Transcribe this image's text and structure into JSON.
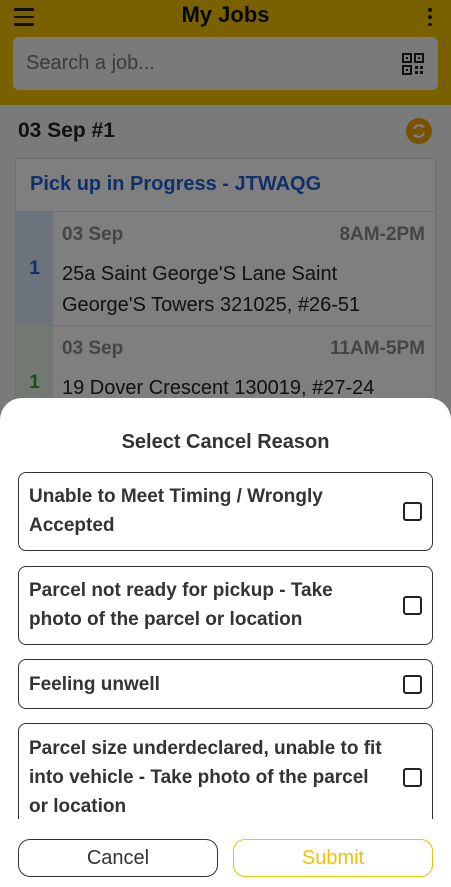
{
  "app_bar": {
    "title": "My Jobs"
  },
  "search": {
    "placeholder": "Search a job..."
  },
  "group": {
    "date_label": "03 Sep #1"
  },
  "card": {
    "status": "Pick up in Progress - JTWAQG",
    "jobs": [
      {
        "seq": "1",
        "date": "03 Sep",
        "time": "8AM-2PM",
        "address": "25a Saint George'S Lane Saint George'S Towers 321025, #26-51",
        "color": "#1e63d6",
        "stripe": "#dbe6f8"
      },
      {
        "seq": "1",
        "date": "03 Sep",
        "time": "11AM-5PM",
        "address": "19 Dover Crescent 130019, #27-24",
        "color": "#2e9b3a",
        "stripe": "#e3f2e0"
      }
    ]
  },
  "cancel_sheet": {
    "title": "Select Cancel Reason",
    "reasons": [
      {
        "label": "Unable to Meet Timing / Wrongly Accepted",
        "checked": false
      },
      {
        "label": "Parcel not ready for pickup - Take photo of the parcel or location",
        "checked": false
      },
      {
        "label": "Feeling unwell",
        "checked": false
      },
      {
        "label": "Parcel size underdeclared, unable to fit into vehicle - Take photo of the parcel or location",
        "checked": false
      }
    ],
    "cancel_label": "Cancel",
    "submit_label": "Submit"
  },
  "colors": {
    "brand": "#f2c200",
    "status_link": "#1e63d6"
  }
}
